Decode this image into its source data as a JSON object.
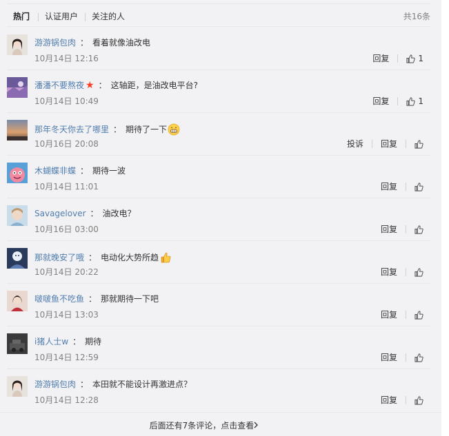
{
  "tabs": {
    "hot": "热门",
    "verified": "认证用户",
    "followed": "关注的人",
    "total": "共16条"
  },
  "comments": [
    {
      "user": "游游锅包肉",
      "text": "看着就像油改电",
      "time": "10月14日 12:16",
      "reply": "回复",
      "likes": "1"
    },
    {
      "user": "潘潘不要熬夜",
      "badge": "★",
      "text": "这轴距，是油改电平台?",
      "time": "10月14日 10:49",
      "reply": "回复",
      "likes": "1"
    },
    {
      "user": "那年冬天你去了哪里",
      "text": "期待了一下",
      "emoji": "grin-emoji",
      "time": "10月16日 20:08",
      "report": "投诉",
      "reply": "回复",
      "likes": ""
    },
    {
      "user": "木蝴蝶非蝶",
      "text": "期待一波",
      "time": "10月14日 11:01",
      "reply": "回复",
      "likes": ""
    },
    {
      "user": "Savagelover",
      "text": "油改电？",
      "time": "10月16日 03:00",
      "reply": "回复",
      "likes": ""
    },
    {
      "user": "那就晚安了哦",
      "text": "电动化大势所趋",
      "emoji": "thumbs-up-emoji",
      "time": "10月14日 20:22",
      "reply": "回复",
      "likes": ""
    },
    {
      "user": "啵啵鱼不吃鱼",
      "text": "那就期待一下吧",
      "time": "10月14日 13:03",
      "reply": "回复",
      "likes": ""
    },
    {
      "user": "i猪人士w",
      "text": "期待",
      "time": "10月14日 12:59",
      "reply": "回复",
      "likes": ""
    },
    {
      "user": "游游锅包肉",
      "text": "本田就不能设计再激进点？",
      "time": "10月14日 12:28",
      "reply": "回复",
      "likes": ""
    }
  ],
  "more": {
    "text": "后面还有7条评论，点击查看",
    "chevron": "chevron-right-icon"
  },
  "colors": {
    "username": "#507daf",
    "background": "#f2f2f5",
    "muted": "#808080",
    "star": "#ff3b20"
  }
}
